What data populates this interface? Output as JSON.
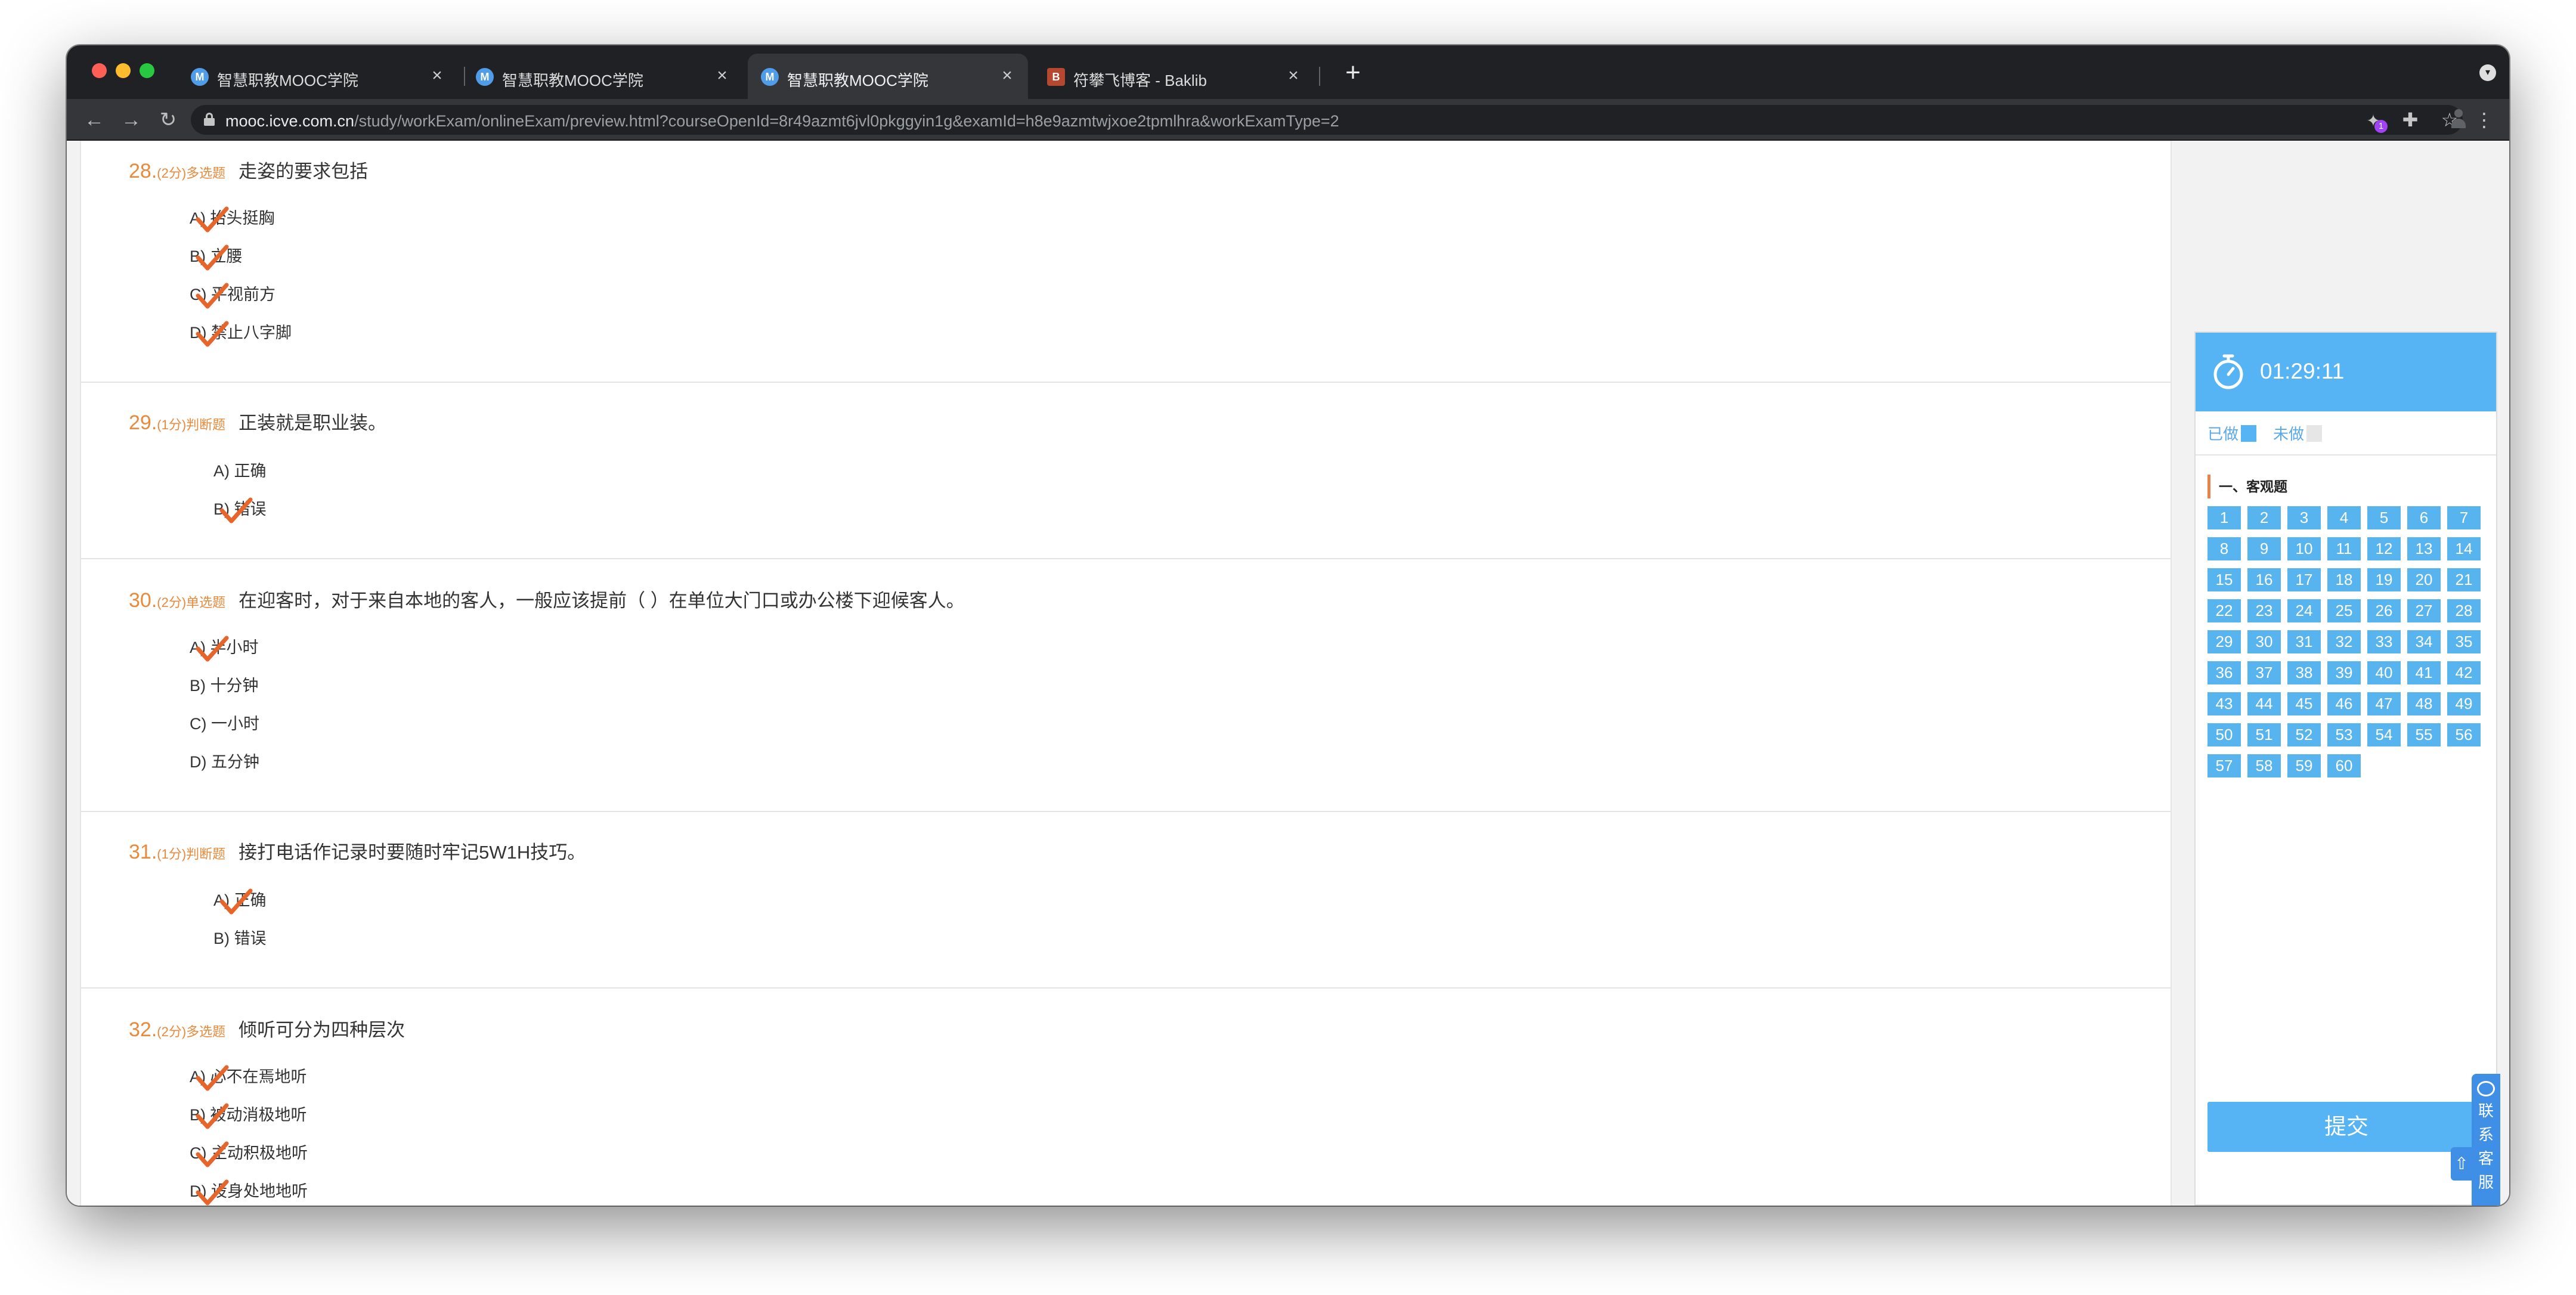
{
  "browser": {
    "tabs": [
      {
        "title": "智慧职教MOOC学院",
        "favicon": "M",
        "active": false
      },
      {
        "title": "智慧职教MOOC学院",
        "favicon": "M",
        "active": false
      },
      {
        "title": "智慧职教MOOC学院",
        "favicon": "M",
        "active": true
      },
      {
        "title": "符攀飞博客 - Baklib",
        "favicon": "B",
        "active": false
      }
    ],
    "url_host": "mooc.icve.com.cn",
    "url_path": "/study/workExam/onlineExam/preview.html?courseOpenId=8r49azmt6jvl0pkggyin1g&examId=h8e9azmtwjxoe2tpmlhra&workExamType=2",
    "extension_badge": "1",
    "new_tab_label": "+",
    "close_label": "×"
  },
  "exam": {
    "questions": [
      {
        "num": "28.",
        "score": "(2分)",
        "type": "多选题",
        "text": "走姿的要求包括",
        "options": [
          {
            "label": "A) 抬头挺胸",
            "checked": true
          },
          {
            "label": "B) 立腰",
            "checked": true
          },
          {
            "label": "C) 平视前方",
            "checked": true
          },
          {
            "label": "D) 禁止八字脚",
            "checked": true
          }
        ]
      },
      {
        "num": "29.",
        "score": "(1分)",
        "type": "判断题",
        "text": "正装就是职业装。",
        "options": [
          {
            "label": "A) 正确",
            "checked": false
          },
          {
            "label": "B) 错误",
            "checked": true
          }
        ]
      },
      {
        "num": "30.",
        "score": "(2分)",
        "type": "单选题",
        "text": "在迎客时，对于来自本地的客人，一般应该提前（ ）在单位大门口或办公楼下迎候客人。",
        "options": [
          {
            "label": "A) 半小时",
            "checked": true
          },
          {
            "label": "B) 十分钟",
            "checked": false
          },
          {
            "label": "C) 一小时",
            "checked": false
          },
          {
            "label": "D) 五分钟",
            "checked": false
          }
        ]
      },
      {
        "num": "31.",
        "score": "(1分)",
        "type": "判断题",
        "text": "接打电话作记录时要随时牢记5W1H技巧。",
        "options": [
          {
            "label": "A) 正确",
            "checked": true
          },
          {
            "label": "B) 错误",
            "checked": false
          }
        ]
      },
      {
        "num": "32.",
        "score": "(2分)",
        "type": "多选题",
        "text": "倾听可分为四种层次",
        "options": [
          {
            "label": "A) 心不在焉地听",
            "checked": true
          },
          {
            "label": "B) 被动消极地听",
            "checked": true
          },
          {
            "label": "C) 主动积极地听",
            "checked": true
          },
          {
            "label": "D) 设身处地地听",
            "checked": true
          }
        ]
      }
    ]
  },
  "panel": {
    "timer": "01:29:11",
    "legend_done": "已做",
    "legend_todo": "未做",
    "section_title": "一、客观题",
    "numbers": [
      "1",
      "2",
      "3",
      "4",
      "5",
      "6",
      "7",
      "8",
      "9",
      "10",
      "11",
      "12",
      "13",
      "14",
      "15",
      "16",
      "17",
      "18",
      "19",
      "20",
      "21",
      "22",
      "23",
      "24",
      "25",
      "26",
      "27",
      "28",
      "29",
      "30",
      "31",
      "32",
      "33",
      "34",
      "35",
      "36",
      "37",
      "38",
      "39",
      "40",
      "41",
      "42",
      "43",
      "44",
      "45",
      "46",
      "47",
      "48",
      "49",
      "50",
      "51",
      "52",
      "53",
      "54",
      "55",
      "56",
      "57",
      "58",
      "59",
      "60"
    ],
    "submit_label": "提交",
    "contact_label": "联系客服"
  },
  "colors": {
    "accent_blue": "#56b3f4",
    "answered_box": "#57b4ee",
    "unanswered_box": "#e6e6e6",
    "question_orange": "#e88a3c",
    "check_orange": "#e8652a"
  }
}
